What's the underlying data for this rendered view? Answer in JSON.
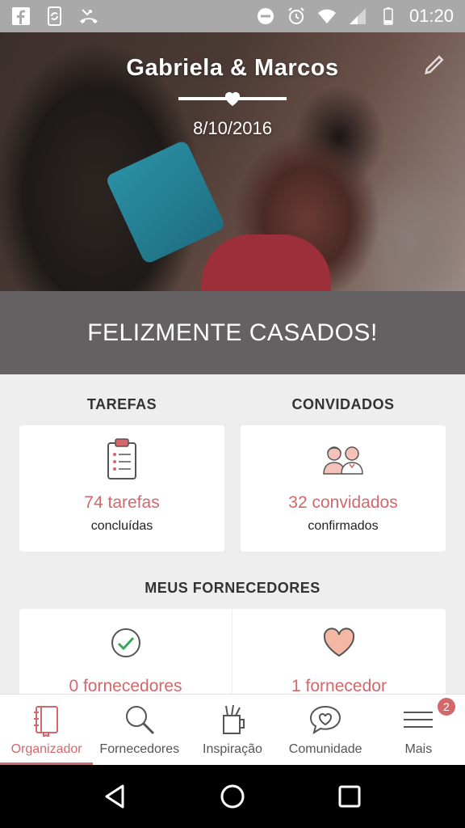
{
  "status_bar": {
    "time": "01:20",
    "left_icons": [
      "facebook-icon",
      "phone-sync-icon",
      "missed-call-icon"
    ],
    "right_icons": [
      "do-not-disturb-icon",
      "alarm-icon",
      "wifi-icon",
      "signal-icon",
      "battery-icon"
    ]
  },
  "hero": {
    "couple_names": "Gabriela & Marcos",
    "date": "8/10/2016"
  },
  "banner": {
    "text": "FELIZMENTE CASADOS!"
  },
  "tasks": {
    "title": "TAREFAS",
    "count": "74 tarefas",
    "subtitle": "concluídas"
  },
  "guests": {
    "title": "CONVIDADOS",
    "count": "32 convidados",
    "subtitle": "confirmados"
  },
  "vendors": {
    "title": "MEUS FORNECEDORES",
    "hired": {
      "count": "0 fornecedores"
    },
    "favorites": {
      "count": "1 fornecedor"
    }
  },
  "bottom_nav": {
    "items": [
      {
        "label": "Organizador",
        "icon": "notebook-icon",
        "active": true
      },
      {
        "label": "Fornecedores",
        "icon": "search-icon"
      },
      {
        "label": "Inspiração",
        "icon": "inspiration-cup-icon"
      },
      {
        "label": "Comunidade",
        "icon": "chat-heart-icon"
      },
      {
        "label": "Mais",
        "icon": "menu-icon",
        "badge": "2"
      }
    ]
  },
  "colors": {
    "accent": "#d2686c",
    "banner": "#656061",
    "background": "#efeeee"
  }
}
